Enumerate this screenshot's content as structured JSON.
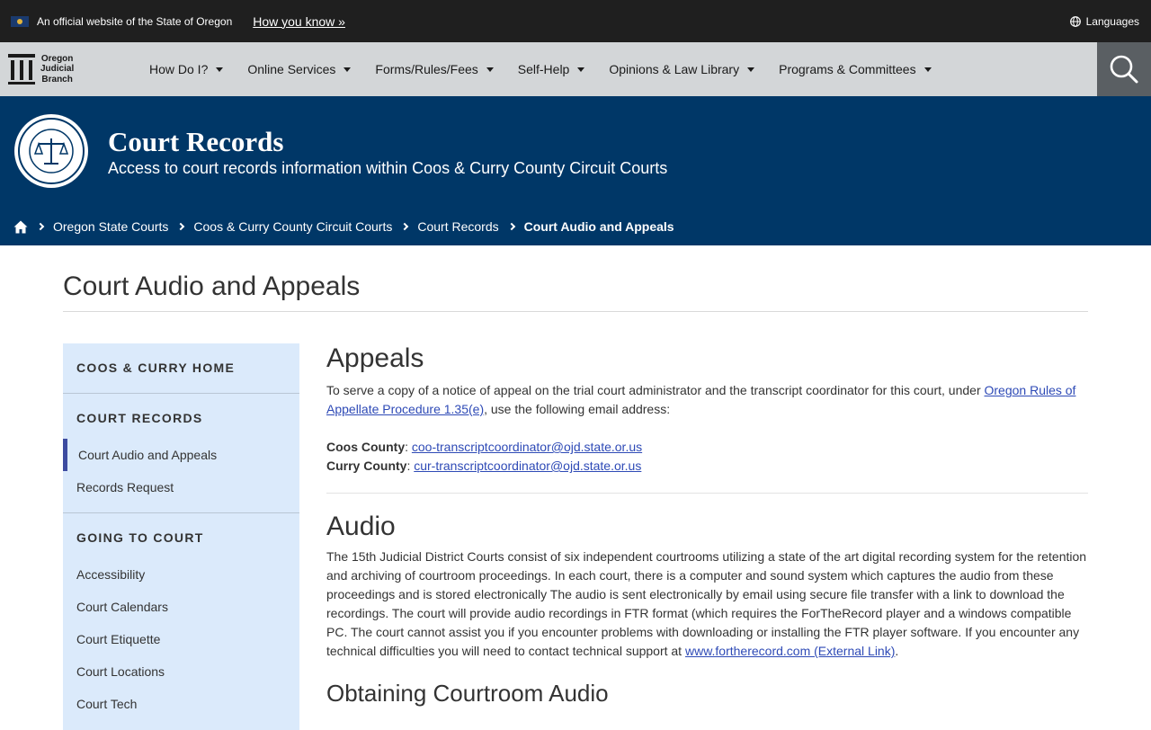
{
  "gov_banner": {
    "text": "An official website of the State of Oregon",
    "how_link": "How you know »",
    "languages": "Languages"
  },
  "logo": {
    "line1": "Oregon",
    "line2": "Judicial",
    "line3": "Branch"
  },
  "nav": {
    "items": [
      {
        "label": "How Do I?"
      },
      {
        "label": "Online Services"
      },
      {
        "label": "Forms/Rules/Fees"
      },
      {
        "label": "Self-Help"
      },
      {
        "label": "Opinions & Law Library"
      },
      {
        "label": "Programs & Committees"
      }
    ],
    "search_icon": "search-icon"
  },
  "hero": {
    "title": "Court Records",
    "subtitle": "Access to court records information within Coos & Curry County Circuit Courts"
  },
  "breadcrumb": {
    "items": [
      "Oregon State Courts",
      "Coos & Curry County Circuit Courts",
      "Court Records",
      "Court Audio and Appeals"
    ]
  },
  "page_title": "Court Audio and Appeals",
  "sidebar": {
    "sections": [
      {
        "heading": "COOS & CURRY HOME",
        "items": []
      },
      {
        "heading": "COURT RECORDS",
        "items": [
          "Court Audio and Appeals",
          "Records Request"
        ]
      },
      {
        "heading": "GOING TO COURT",
        "items": [
          "Accessibility",
          "Court Calendars",
          "Court Etiquette",
          "Court Locations",
          "Court Tech"
        ]
      }
    ]
  },
  "content": {
    "appeals_heading": "Appeals",
    "appeals_text_1": "To serve a copy of a notice of appeal on the trial court administrator and the transcript coordinator for this court, under ",
    "appeals_link": "Oregon Rules of Appellate Procedure 1.35(e)",
    "appeals_text_2": ", use the following email address:",
    "coos_label": "Coos County",
    "coos_email": "coo-transcriptcoordinator@ojd.state.or.us",
    "curry_label": "Curry County",
    "curry_email": "cur-transcriptcoordinator@ojd.state.or.us",
    "audio_heading": "Audio",
    "audio_text": "The 15th Judicial District Courts consist of six independent courtrooms utilizing a state of the art digital recording system for the retention and archiving of courtroom proceedings. In each court, there is a computer and sound system which captures the audio from these proceedings and is stored electronically  The audio is sent electronically by email using secure file transfer with a link to download the recordings.  The court will provide audio recordings in FTR format (which requires the ForTheRecord player and a windows compatible PC.  The court cannot assist you if you encounter problems with downloading or installing the FTR player software.  If you encounter any technical difficulties you will need to contact technical support at ",
    "audio_link": "www.fortherecord.com (External Link)",
    "audio_end": ".",
    "obtaining_heading": "Obtaining Courtroom Audio"
  },
  "colors": {
    "banner": "#1f1f1f",
    "nav": "#d3d6d8",
    "hero": "#003767",
    "sidebar": "#dbeafb",
    "link": "#2e4ab6",
    "active": "#3d4ba0"
  }
}
